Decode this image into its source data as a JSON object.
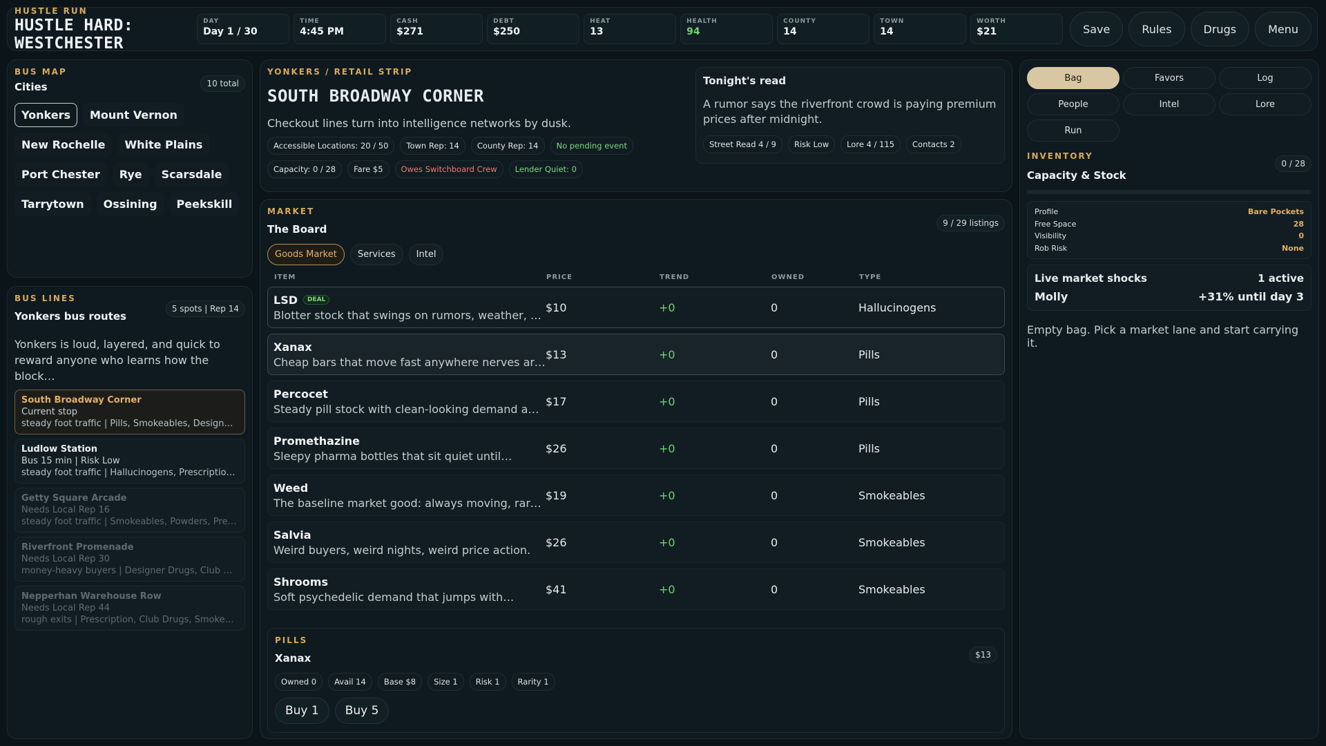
{
  "header": {
    "eyebrow": "HUSTLE RUN",
    "title": "HUSTLE HARD: WESTCHESTER",
    "stats": [
      {
        "label": "DAY",
        "value": "Day 1 / 30"
      },
      {
        "label": "TIME",
        "value": "4:45 PM"
      },
      {
        "label": "CASH",
        "value": "$271"
      },
      {
        "label": "DEBT",
        "value": "$250"
      },
      {
        "label": "HEAT",
        "value": "13"
      },
      {
        "label": "HEALTH",
        "value": "94"
      },
      {
        "label": "COUNTY",
        "value": "14"
      },
      {
        "label": "TOWN",
        "value": "14"
      },
      {
        "label": "WORTH",
        "value": "$21"
      }
    ],
    "buttons": [
      "Save",
      "Rules",
      "Drugs",
      "Menu"
    ],
    "health_color": "#6fd36f"
  },
  "bus_map": {
    "eyebrow": "BUS MAP",
    "title": "Cities",
    "count": "10 total",
    "cities": [
      "Yonkers",
      "Mount Vernon",
      "New Rochelle",
      "White Plains",
      "Port Chester",
      "Rye",
      "Scarsdale",
      "Tarrytown",
      "Ossining",
      "Peekskill"
    ],
    "active_city": "Yonkers"
  },
  "bus_lines": {
    "eyebrow": "BUS LINES",
    "title": "Yonkers bus routes",
    "count": "5 spots | Rep 14",
    "description": "Yonkers is loud, layered, and quick to reward anyone who learns how the block…",
    "stops": [
      {
        "name": "South Broadway Corner",
        "status": "Current stop",
        "detail": "steady foot traffic | Pills, Smokeables, Designer …"
      },
      {
        "name": "Ludlow Station",
        "status": "Bus 15 min | Risk Low",
        "detail": "steady foot traffic | Hallucinogens, Prescription…"
      },
      {
        "name": "Getty Square Arcade",
        "status": "Needs Local Rep 16",
        "detail": "steady foot traffic | Smokeables, Powders, Pres…"
      },
      {
        "name": "Riverfront Promenade",
        "status": "Needs Local Rep 30",
        "detail": "money-heavy buyers | Designer Drugs, Club Dru…"
      },
      {
        "name": "Nepperhan Warehouse Row",
        "status": "Needs Local Rep 44",
        "detail": "rough exits | Prescription, Club Drugs, Smokeabl…"
      }
    ]
  },
  "location": {
    "eyebrow": "YONKERS / RETAIL STRIP",
    "title": "SOUTH BROADWAY CORNER",
    "subtitle": "Checkout lines turn into intelligence networks by dusk.",
    "chips": [
      "Accessible Locations: 20 / 50",
      "Town Rep: 14",
      "County Rep: 14",
      "No pending event",
      "Capacity: 0 / 28",
      "Fare $5",
      "Owes Switchboard Crew",
      "Lender Quiet: 0"
    ],
    "read": {
      "title": "Tonight's read",
      "text": "A rumor says the riverfront crowd is paying premium prices after midnight.",
      "chips": [
        "Street Read 4 / 9",
        "Risk Low",
        "Lore 4 / 115",
        "Contacts 2"
      ]
    }
  },
  "market": {
    "eyebrow": "MARKET",
    "title": "The Board",
    "count": "9 / 29 listings",
    "tabs": [
      "Goods Market",
      "Services",
      "Intel"
    ],
    "columns": [
      "ITEM",
      "PRICE",
      "TREND",
      "OWNED",
      "TYPE"
    ],
    "deal_label": "DEAL",
    "rows": [
      {
        "name": "LSD",
        "desc": "Blotter stock that swings on rumors, weather, and gossip.",
        "price": "$10",
        "trend": "+0",
        "owned": "0",
        "type": "Hallucinogens"
      },
      {
        "name": "Xanax",
        "desc": "Cheap bars that move fast anywhere nerves are frayed.",
        "price": "$13",
        "trend": "+0",
        "owned": "0",
        "type": "Pills"
      },
      {
        "name": "Percocet",
        "desc": "Steady pill stock with clean-looking demand and margins.",
        "price": "$17",
        "trend": "+0",
        "owned": "0",
        "type": "Pills"
      },
      {
        "name": "Promethazine",
        "desc": "Sleepy pharma bottles that sit quiet until…",
        "price": "$26",
        "trend": "+0",
        "owned": "0",
        "type": "Pills"
      },
      {
        "name": "Weed",
        "desc": "The baseline market good: always moving, rarely spectacular.",
        "price": "$19",
        "trend": "+0",
        "owned": "0",
        "type": "Smokeables"
      },
      {
        "name": "Salvia",
        "desc": "Weird buyers, weird nights, weird price action.",
        "price": "$26",
        "trend": "+0",
        "owned": "0",
        "type": "Smokeables"
      },
      {
        "name": "Shrooms",
        "desc": "Soft psychedelic demand that jumps with…",
        "price": "$41",
        "trend": "+0",
        "owned": "0",
        "type": "Smokeables"
      }
    ],
    "detail": {
      "eyebrow": "PILLS",
      "name": "Xanax",
      "price": "$13",
      "chips": [
        "Owned 0",
        "Avail 14",
        "Base $8",
        "Size 1",
        "Risk 1",
        "Rarity 1"
      ],
      "buttons": [
        "Buy 1",
        "Buy 5"
      ]
    }
  },
  "sidebar": {
    "tabs": [
      "Bag",
      "Favors",
      "Log",
      "People",
      "Intel",
      "Lore",
      "Run"
    ],
    "eyebrow": "INVENTORY",
    "title": "Capacity & Stock",
    "count": "0 / 28",
    "capacity_fraction": 0,
    "profile": [
      {
        "k": "Profile",
        "v": "Bare Pockets"
      },
      {
        "k": "Free Space",
        "v": "28"
      },
      {
        "k": "Visibility",
        "v": "0"
      },
      {
        "k": "Rob Risk",
        "v": "None"
      }
    ],
    "shocks": {
      "title": "Live market shocks",
      "count": "1 active",
      "item": "Molly",
      "effect": "+31% until day 3"
    },
    "empty": "Empty bag. Pick a market lane and start carrying it."
  }
}
